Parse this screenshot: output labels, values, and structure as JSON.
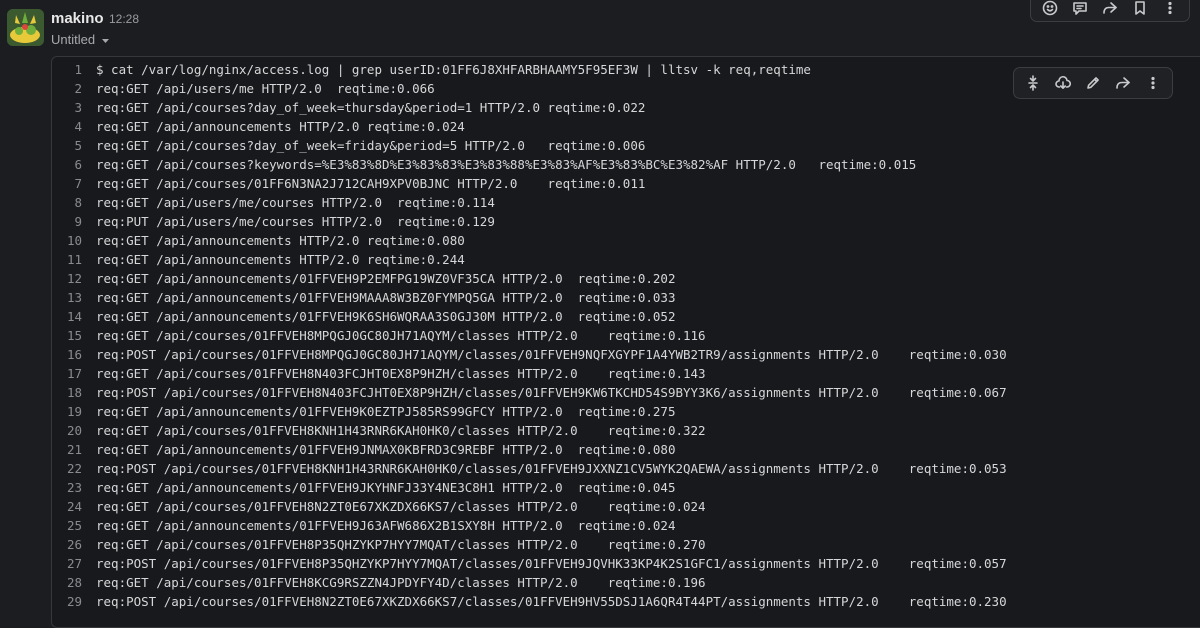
{
  "message": {
    "username": "makino",
    "timestamp": "12:28",
    "subtitle": "Untitled"
  },
  "icons": {
    "message_actions": [
      "emoji-reaction-icon",
      "reply-thread-icon",
      "forward-icon",
      "bookmark-icon",
      "more-vertical-icon"
    ],
    "code_actions": [
      "collapse-icon",
      "download-icon",
      "edit-icon",
      "share-icon",
      "more-vertical-icon"
    ]
  },
  "code_lines": [
    "$ cat /var/log/nginx/access.log | grep userID:01FF6J8XHFARBHAAMY5F95EF3W | lltsv -k req,reqtime",
    "req:GET /api/users/me HTTP/2.0  reqtime:0.066",
    "req:GET /api/courses?day_of_week=thursday&period=1 HTTP/2.0 reqtime:0.022",
    "req:GET /api/announcements HTTP/2.0 reqtime:0.024",
    "req:GET /api/courses?day_of_week=friday&period=5 HTTP/2.0   reqtime:0.006",
    "req:GET /api/courses?keywords=%E3%83%8D%E3%83%83%E3%83%88%E3%83%AF%E3%83%BC%E3%82%AF HTTP/2.0   reqtime:0.015",
    "req:GET /api/courses/01FF6N3NA2J712CAH9XPV0BJNC HTTP/2.0    reqtime:0.011",
    "req:GET /api/users/me/courses HTTP/2.0  reqtime:0.114",
    "req:PUT /api/users/me/courses HTTP/2.0  reqtime:0.129",
    "req:GET /api/announcements HTTP/2.0 reqtime:0.080",
    "req:GET /api/announcements HTTP/2.0 reqtime:0.244",
    "req:GET /api/announcements/01FFVEH9P2EMFPG19WZ0VF35CA HTTP/2.0  reqtime:0.202",
    "req:GET /api/announcements/01FFVEH9MAAA8W3BZ0FYMPQ5GA HTTP/2.0  reqtime:0.033",
    "req:GET /api/announcements/01FFVEH9K6SH6WQRAA3S0GJ30M HTTP/2.0  reqtime:0.052",
    "req:GET /api/courses/01FFVEH8MPQGJ0GC80JH71AQYM/classes HTTP/2.0    reqtime:0.116",
    "req:POST /api/courses/01FFVEH8MPQGJ0GC80JH71AQYM/classes/01FFVEH9NQFXGYPF1A4YWB2TR9/assignments HTTP/2.0    reqtime:0.030",
    "req:GET /api/courses/01FFVEH8N403FCJHT0EX8P9HZH/classes HTTP/2.0    reqtime:0.143",
    "req:POST /api/courses/01FFVEH8N403FCJHT0EX8P9HZH/classes/01FFVEH9KW6TKCHD54S9BYY3K6/assignments HTTP/2.0    reqtime:0.067",
    "req:GET /api/announcements/01FFVEH9K0EZTPJ585RS99GFCY HTTP/2.0  reqtime:0.275",
    "req:GET /api/courses/01FFVEH8KNH1H43RNR6KAH0HK0/classes HTTP/2.0    reqtime:0.322",
    "req:GET /api/announcements/01FFVEH9JNMAX0KBFRD3C9REBF HTTP/2.0  reqtime:0.080",
    "req:POST /api/courses/01FFVEH8KNH1H43RNR6KAH0HK0/classes/01FFVEH9JXXNZ1CV5WYK2QAEWA/assignments HTTP/2.0    reqtime:0.053",
    "req:GET /api/announcements/01FFVEH9JKYHNFJ33Y4NE3C8H1 HTTP/2.0  reqtime:0.045",
    "req:GET /api/courses/01FFVEH8N2ZT0E67XKZDX66KS7/classes HTTP/2.0    reqtime:0.024",
    "req:GET /api/announcements/01FFVEH9J63AFW686X2B1SXY8H HTTP/2.0  reqtime:0.024",
    "req:GET /api/courses/01FFVEH8P35QHZYKP7HYY7MQAT/classes HTTP/2.0    reqtime:0.270",
    "req:POST /api/courses/01FFVEH8P35QHZYKP7HYY7MQAT/classes/01FFVEH9JQVHK33KP4K2S1GFC1/assignments HTTP/2.0    reqtime:0.057",
    "req:GET /api/courses/01FFVEH8KCG9RSZZN4JPDYFY4D/classes HTTP/2.0    reqtime:0.196",
    "req:POST /api/courses/01FFVEH8N2ZT0E67XKZDX66KS7/classes/01FFVEH9HV55DSJ1A6QR4T44PT/assignments HTTP/2.0    reqtime:0.230"
  ]
}
